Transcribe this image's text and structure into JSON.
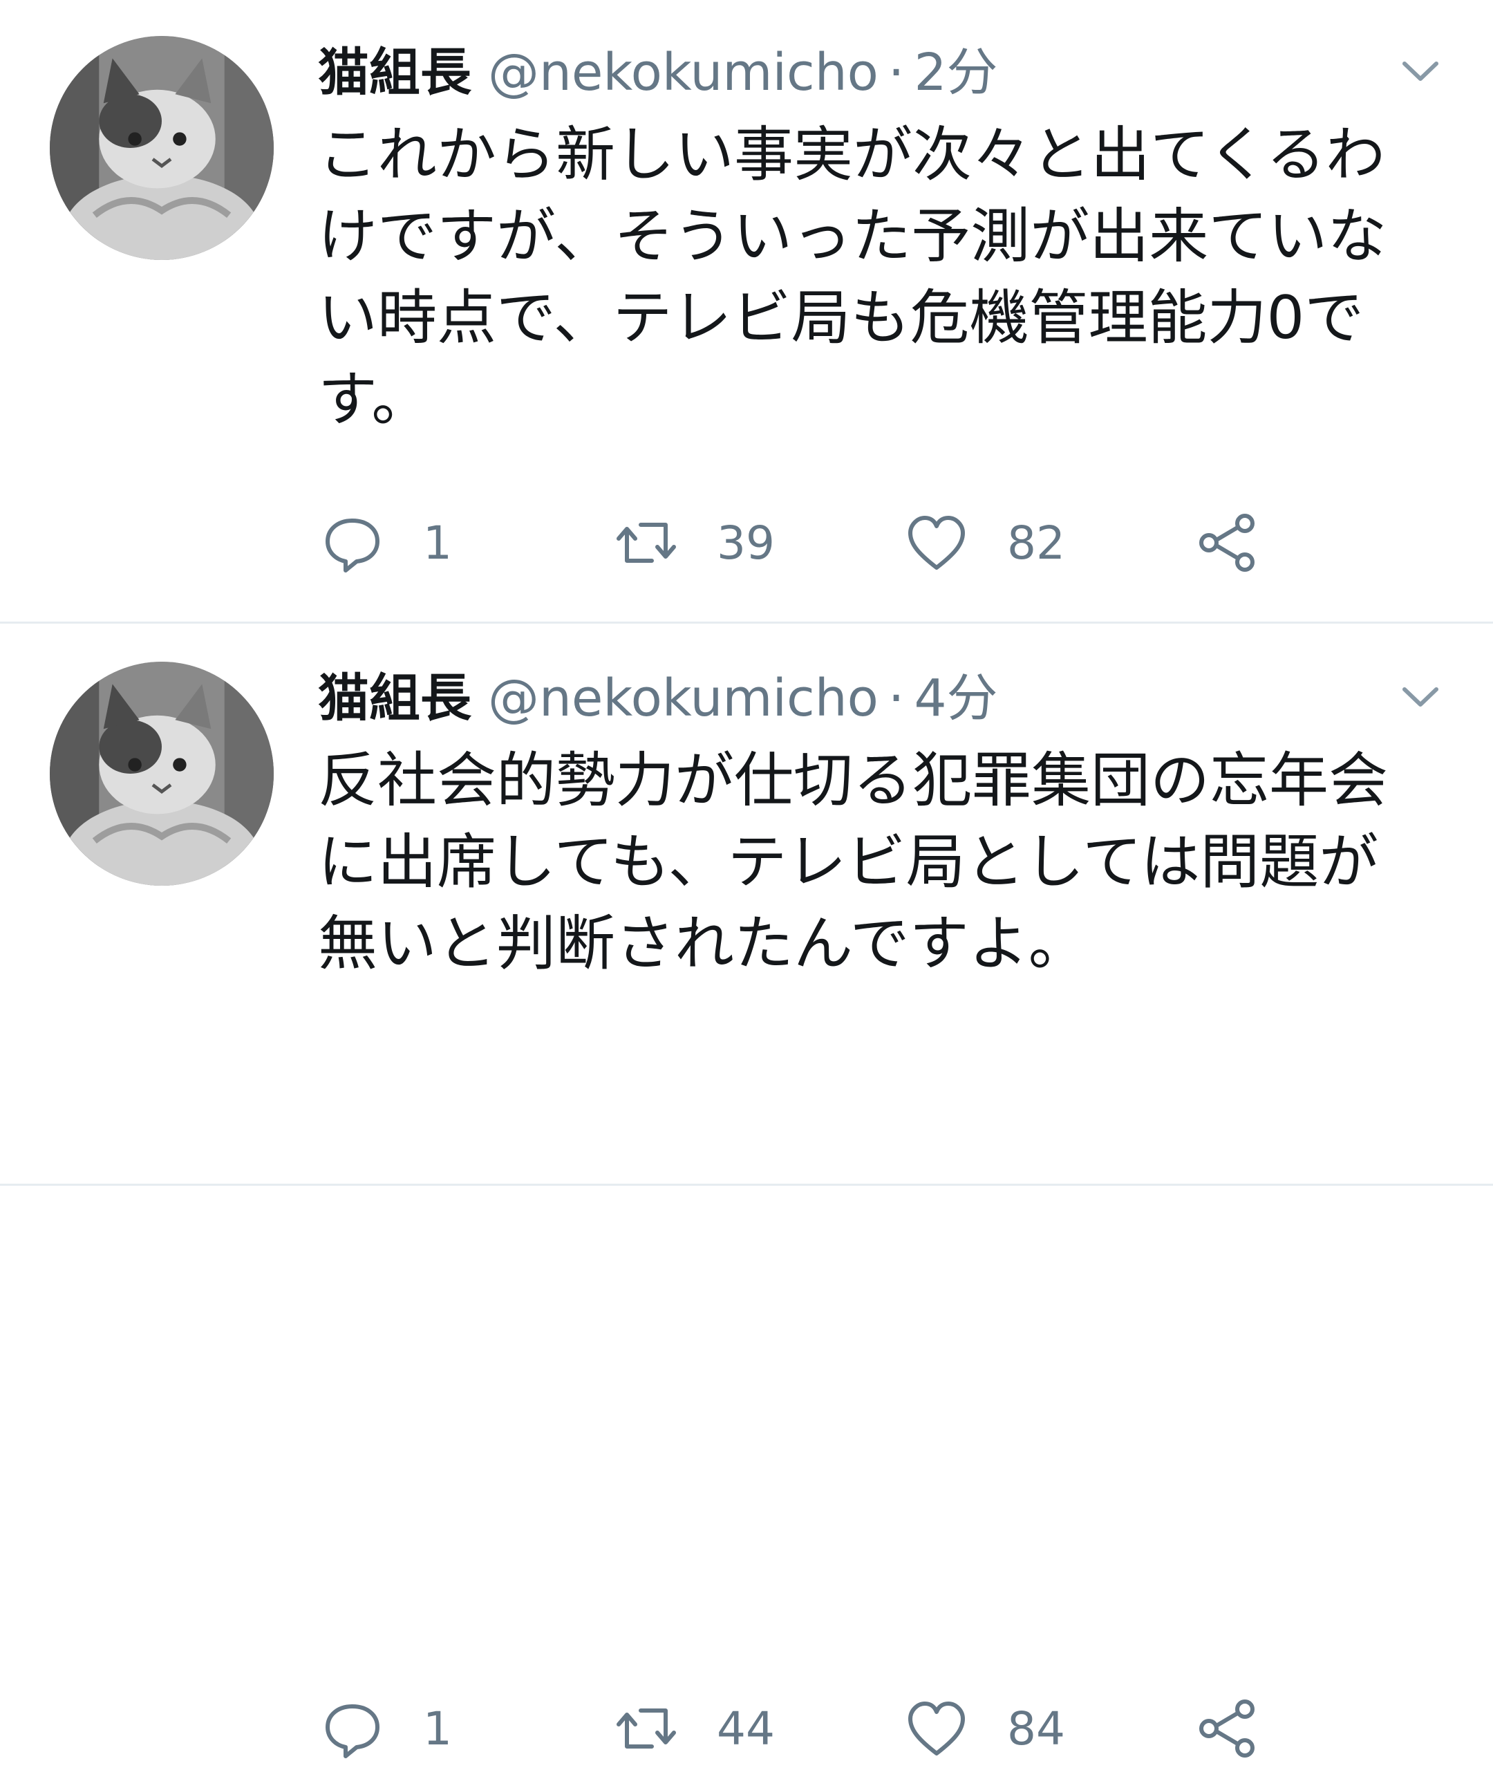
{
  "tweets": [
    {
      "display_name": "猫組長",
      "handle": "@nekokumicho",
      "separator": "·",
      "time": "2分",
      "text": "これから新しい事実が次々と出てくるわけですが、そういった予測が出来ていない時点で、テレビ局も危機管理能力0です。",
      "replies": "1",
      "retweets": "39",
      "likes": "82"
    },
    {
      "display_name": "猫組長",
      "handle": "@nekokumicho",
      "separator": "·",
      "time": "4分",
      "text": "反社会的勢力が仕切る犯罪集団の忘年会に出席しても、テレビ局としては問題が無いと判断されたんですよ。",
      "replies": "1",
      "retweets": "44",
      "likes": "84"
    }
  ],
  "icons": {
    "avatar": "cat-avatar",
    "caret": "chevron-down-icon",
    "reply": "reply-icon",
    "retweet": "retweet-icon",
    "like": "heart-icon",
    "share": "share-icon"
  },
  "colors": {
    "text_primary": "#14171a",
    "text_secondary": "#657786",
    "divider": "#e6ecf0",
    "background": "#ffffff"
  }
}
